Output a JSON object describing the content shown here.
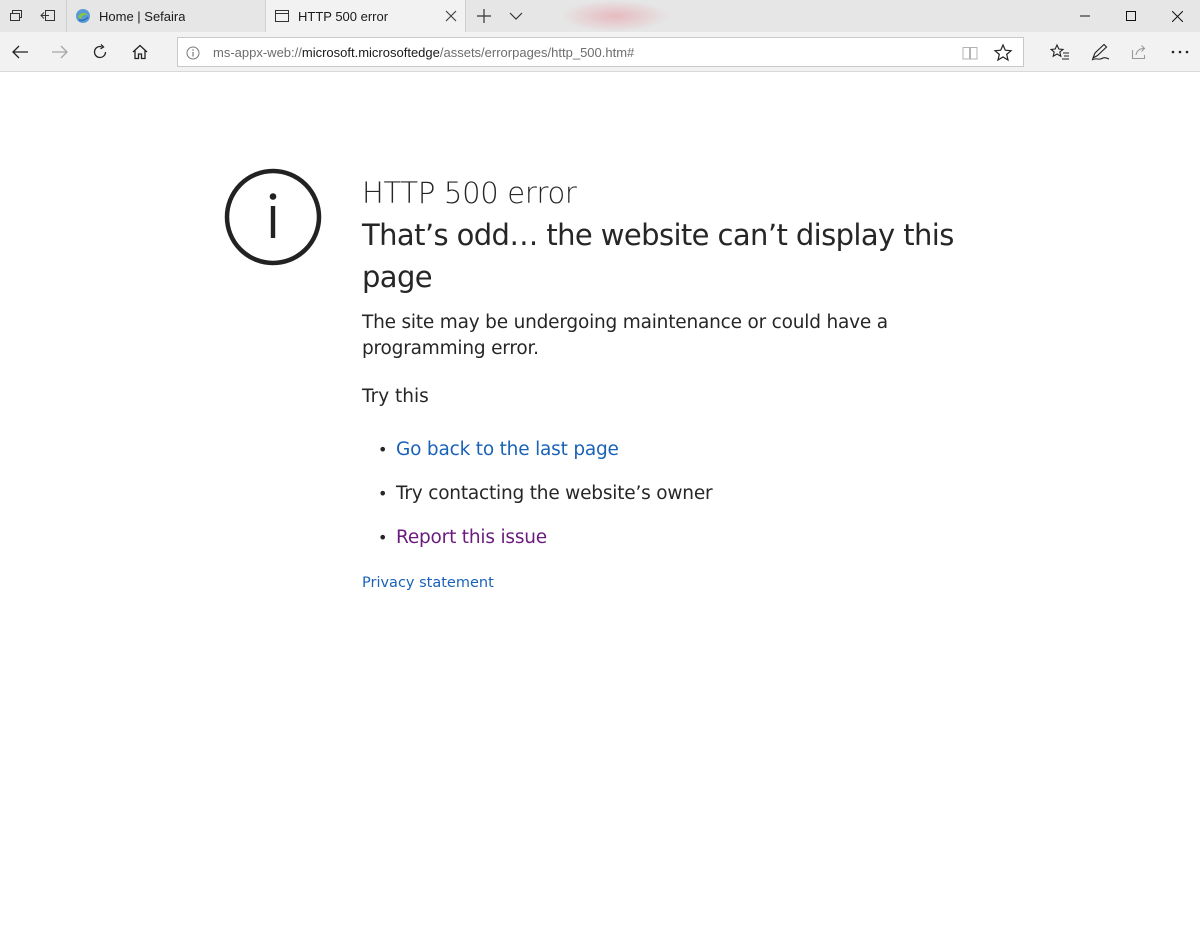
{
  "browser": {
    "tabs": [
      {
        "title": "Home | Sefaira",
        "favicon": "sefaira-logo-icon",
        "active": false
      },
      {
        "title": "HTTP 500 error",
        "favicon": "page-icon",
        "active": true
      }
    ],
    "address": {
      "scheme": "ms-appx-web://",
      "host": "microsoft.microsoftedge",
      "path": "/assets/errorpages/http_500.htm#"
    },
    "toolbar_icons": [
      "back-icon",
      "forward-icon",
      "refresh-icon",
      "home-icon",
      "reading-view-icon",
      "favorite-star-icon",
      "favorites-hub-icon",
      "web-note-icon",
      "share-icon",
      "more-icon"
    ]
  },
  "page": {
    "title": "HTTP 500 error",
    "subtitle": "That’s odd… the website can’t display this page",
    "description": "The site may be undergoing maintenance or could have a programming error.",
    "try_heading": "Try this",
    "suggestions": [
      {
        "text": "Go back to the last page",
        "kind": "link",
        "color": "#1a62b8"
      },
      {
        "text": "Try contacting the website’s owner",
        "kind": "text",
        "color": "#262626"
      },
      {
        "text": "Report this issue",
        "kind": "visited-link",
        "color": "#6a1b7e"
      }
    ],
    "privacy_link": "Privacy statement"
  },
  "colors": {
    "link": "#1a62b8",
    "visited_link": "#6a1b7e",
    "chrome_bg": "#f2f2f2",
    "tabstrip_bg": "#e6e6e6"
  }
}
